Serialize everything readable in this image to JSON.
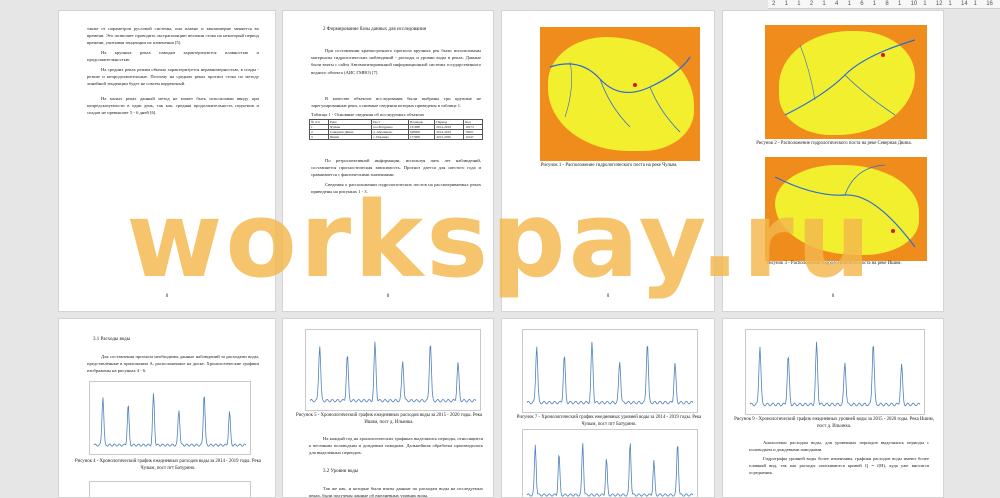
{
  "ruler": {
    "labels": [
      "2",
      "1",
      "1",
      "2",
      "1",
      "4",
      "1",
      "6",
      "1",
      "8",
      "1",
      "10",
      "1",
      "12",
      "1",
      "14",
      "1",
      "16"
    ]
  },
  "page1": {
    "paragraphs": [
      "также от параметров русловой системы, она плавно и закономерно меняется во времени. Это позволяет проводить экстраполяцию величин стока на некоторый период времени, учитывая тенденции их изменения [5].",
      "На крупных реках паводки характеризуются плавностью и продолжительностью.",
      "На средних реках режим обычно характеризуется неравномерностью, в спады - резкие и непродолжительные. Поэтому на средних реках прогноз стока по методу линейной тенденции будет не совсем корректный.",
      "На малых реках данный метод не может быть использован ввиду при непредсказуемости в одни день, так как, средняя продолжительность подъемов и спадов не превышает 5 - 6 дней [6]."
    ],
    "page_number": "0"
  },
  "page2": {
    "heading": "2 Формирование базы данных для исследования",
    "paragraphs": [
      "При составлении краткосрочного прогноза крупных рек были использованы материалы гидрологических наблюдений - расходы и уровни воды в реках. Данные были взяты с сайта Автоматизированной информационной системы государственного водного объекта (АИС ГМВО) [7].",
      "В качестве объектов исследования были выбраны три крупные не зарегулированные реки, основные сведения которых приведены в таблице 1."
    ],
    "table_caption": "Таблица 1 - Основные сведения об исследуемых объектах",
    "table": {
      "header": [
        "№ п/п",
        "Река",
        "Пост",
        "Площадь",
        "Период",
        "Код"
      ],
      "rows": [
        [
          "1",
          "Чулым",
          "пос.Батурино",
          "131000",
          "2014-2019",
          "10173"
        ],
        [
          "2",
          "Северная Двина",
          "д. Абрамково",
          "348000",
          "2014-2019",
          "70021"
        ],
        [
          "3",
          "Ишим",
          "с. Ильинка",
          "177000",
          "2015-2020",
          "11047"
        ]
      ]
    },
    "paragraphs2": [
      "По ретроспективной информации, используя пять лет наблюдений, составляется прогностическая зависимость. Прогноз дается для шестого года и сравнивается с фактическими значениями.",
      "Сведения о расположении гидрологических постов на рассматриваемых реках приведены на рисунках 1 - 3."
    ],
    "page_number": "0"
  },
  "page3": {
    "caption": "Рисунок 1 - Расположение гидрологического поста на реке Чулым.",
    "page_number": "0"
  },
  "page4": {
    "caption1": "Рисунок 2 - Расположение гидрологического поста на реке Северная Двина.",
    "caption2": "Рисунок 3 - Расположение гидрологического поста на реке Ишим.",
    "page_number": "0"
  },
  "page5": {
    "heading": "3.1 Расходы воды",
    "paragraph": "Для составления прогноза необходимы данные наблюдений за расходами воды, представленные в приложении А, расположенное на диске. Хронологические графики изображены на рисунках 4 - 6.",
    "caption": "Рисунок 4 - Хронологический график ежедневных расходов воды за 2014 - 2019 годы. Река Чулым, пост пгт Батурино."
  },
  "page6": {
    "caption": "Рисунок 5 - Хронологический график ежедневных расходов воды за 2015 - 2020 годы. Река Ишим, пост д. Ильинка.",
    "paragraph": "На каждый год на хронологических графиках выделялись периоды, относящиеся к весенним половодьям и дождевым паводкам. Дальнейшая обработка производилась для выделенных периодов.",
    "heading": "3.2 Уровни воды",
    "paragraph2": "Так же как, и которые были взяты данные по расходам воды на исследуемых реках, были получены данные об ежедневных уровнях воды."
  },
  "page7": {
    "caption": "Рисунок 7 - Хронологический график ежедневных уровней воды за 2014 - 2019 годы. Река Чулым, пост пгт Батурино."
  },
  "page8": {
    "caption": "Рисунок 9 - Хронологический график ежедневных уровней воды за 2015 - 2020 годы. Река Ишим, пост д. Ильинка.",
    "paragraph": "Аналогично расходам воды, для уровенных периодов выделялись периоды с половодьем и дождевыми паводками.",
    "paragraph2": "Гидрографы уровней воды более изменчивы, графики расходов воды имеют более плавный вид, так как расходы описываются кривой Q = f(H), куда уже вносятся осреднения."
  },
  "watermark": "workspay.ru",
  "colors": {
    "map_bg": "#f08c1c",
    "map_land": "#f2ef2e",
    "river": "#2d6bd1",
    "line": "#4f81bd",
    "watermark": "#f3b84d"
  }
}
